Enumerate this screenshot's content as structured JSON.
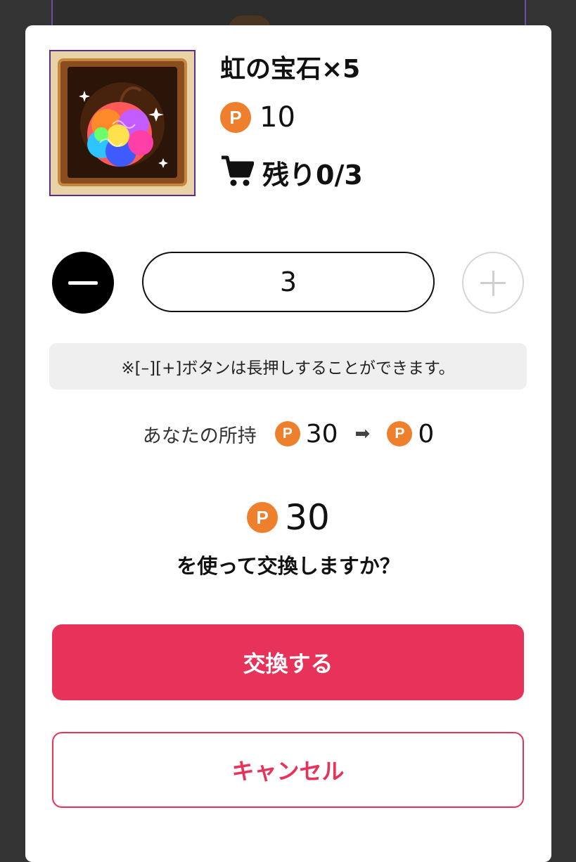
{
  "item": {
    "name": "虹の宝石×5",
    "price": "10",
    "stock": "残り0/3"
  },
  "coin": {
    "letter": "P",
    "color": "#ee7f2d"
  },
  "quantity": {
    "value": "3",
    "minus_icon": "minus-icon",
    "plus_icon": "plus-icon"
  },
  "hint": "※[–][+]ボタンは長押しすることができます。",
  "owned": {
    "label": "あなたの所持",
    "before": "30",
    "arrow": "➡",
    "after": "0"
  },
  "total": {
    "value": "30",
    "confirm": "を使って交換しますか？"
  },
  "buttons": {
    "exchange": "交換する",
    "cancel": "キャンセル"
  },
  "colors": {
    "accent": "#e7335a",
    "coin": "#ee7f2d"
  }
}
